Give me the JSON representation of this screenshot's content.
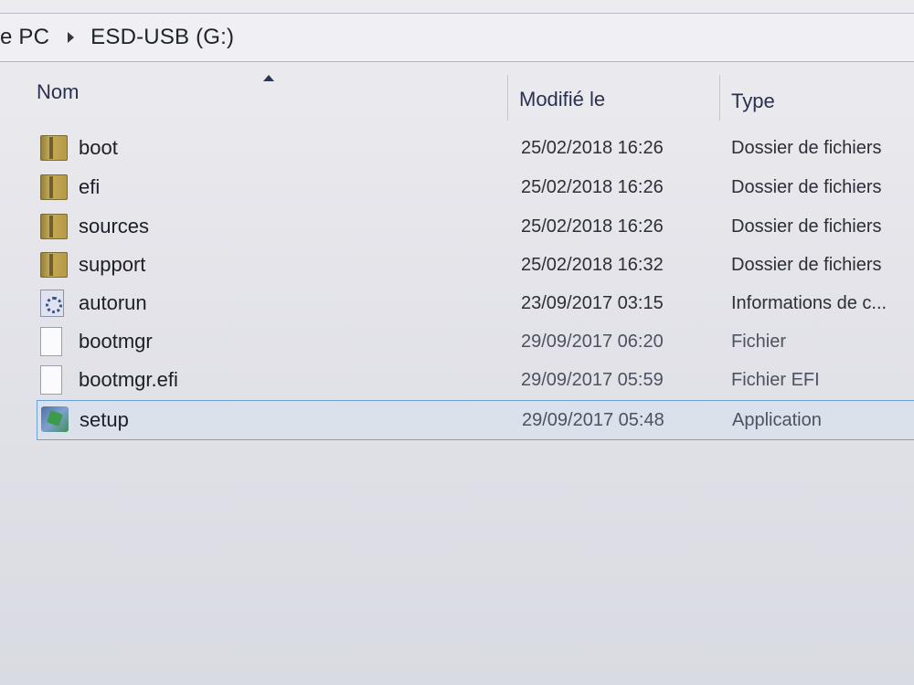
{
  "breadcrumb": {
    "items": [
      "e PC",
      "ESD-USB (G:)"
    ]
  },
  "columns": {
    "name": "Nom",
    "date": "Modifié le",
    "type": "Type",
    "sort": "name-ascending"
  },
  "files": [
    {
      "name": "boot",
      "date": "25/02/2018 16:26",
      "type": "Dossier de fichiers",
      "icon": "folder-icon"
    },
    {
      "name": "efi",
      "date": "25/02/2018 16:26",
      "type": "Dossier de fichiers",
      "icon": "folder-icon"
    },
    {
      "name": "sources",
      "date": "25/02/2018 16:26",
      "type": "Dossier de fichiers",
      "icon": "folder-icon"
    },
    {
      "name": "support",
      "date": "25/02/2018 16:32",
      "type": "Dossier de fichiers",
      "icon": "folder-icon"
    },
    {
      "name": "autorun",
      "date": "23/09/2017 03:15",
      "type": "Informations de c...",
      "icon": "settings-file-icon"
    },
    {
      "name": "bootmgr",
      "date": "29/09/2017 06:20",
      "type": "Fichier",
      "icon": "file-icon"
    },
    {
      "name": "bootmgr.efi",
      "date": "29/09/2017 05:59",
      "type": "Fichier EFI",
      "icon": "file-icon"
    },
    {
      "name": "setup",
      "date": "29/09/2017 05:48",
      "type": "Application",
      "icon": "setup-icon",
      "selected": true
    }
  ],
  "colors": {
    "selection_border": "#6aa3d6",
    "folder": "#c8ab55"
  }
}
